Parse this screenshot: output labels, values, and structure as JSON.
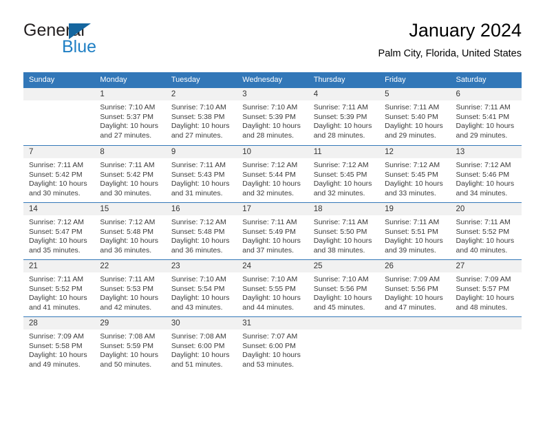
{
  "brand": {
    "name_part1": "General",
    "name_part2": "Blue",
    "triangle_color": "#15669f",
    "blue_color": "#1f7fc4"
  },
  "header": {
    "title": "January 2024",
    "subtitle": "Palm City, Florida, United States"
  },
  "theme": {
    "header_row_bg": "#3277b8",
    "daynum_band_bg": "#f1f1f1",
    "grid_line": "#3277b8",
    "text": "#3a3a3a"
  },
  "weekday_headers": [
    "Sunday",
    "Monday",
    "Tuesday",
    "Wednesday",
    "Thursday",
    "Friday",
    "Saturday"
  ],
  "labels": {
    "sunrise_prefix": "Sunrise:",
    "sunset_prefix": "Sunset:",
    "daylight_prefix": "Daylight:"
  },
  "weeks": [
    [
      {
        "day": "",
        "sunrise": "",
        "sunset": "",
        "daylight_line1": "",
        "daylight_line2": ""
      },
      {
        "day": "1",
        "sunrise": "Sunrise: 7:10 AM",
        "sunset": "Sunset: 5:37 PM",
        "daylight_line1": "Daylight: 10 hours",
        "daylight_line2": "and 27 minutes."
      },
      {
        "day": "2",
        "sunrise": "Sunrise: 7:10 AM",
        "sunset": "Sunset: 5:38 PM",
        "daylight_line1": "Daylight: 10 hours",
        "daylight_line2": "and 27 minutes."
      },
      {
        "day": "3",
        "sunrise": "Sunrise: 7:10 AM",
        "sunset": "Sunset: 5:39 PM",
        "daylight_line1": "Daylight: 10 hours",
        "daylight_line2": "and 28 minutes."
      },
      {
        "day": "4",
        "sunrise": "Sunrise: 7:11 AM",
        "sunset": "Sunset: 5:39 PM",
        "daylight_line1": "Daylight: 10 hours",
        "daylight_line2": "and 28 minutes."
      },
      {
        "day": "5",
        "sunrise": "Sunrise: 7:11 AM",
        "sunset": "Sunset: 5:40 PM",
        "daylight_line1": "Daylight: 10 hours",
        "daylight_line2": "and 29 minutes."
      },
      {
        "day": "6",
        "sunrise": "Sunrise: 7:11 AM",
        "sunset": "Sunset: 5:41 PM",
        "daylight_line1": "Daylight: 10 hours",
        "daylight_line2": "and 29 minutes."
      }
    ],
    [
      {
        "day": "7",
        "sunrise": "Sunrise: 7:11 AM",
        "sunset": "Sunset: 5:42 PM",
        "daylight_line1": "Daylight: 10 hours",
        "daylight_line2": "and 30 minutes."
      },
      {
        "day": "8",
        "sunrise": "Sunrise: 7:11 AM",
        "sunset": "Sunset: 5:42 PM",
        "daylight_line1": "Daylight: 10 hours",
        "daylight_line2": "and 30 minutes."
      },
      {
        "day": "9",
        "sunrise": "Sunrise: 7:11 AM",
        "sunset": "Sunset: 5:43 PM",
        "daylight_line1": "Daylight: 10 hours",
        "daylight_line2": "and 31 minutes."
      },
      {
        "day": "10",
        "sunrise": "Sunrise: 7:12 AM",
        "sunset": "Sunset: 5:44 PM",
        "daylight_line1": "Daylight: 10 hours",
        "daylight_line2": "and 32 minutes."
      },
      {
        "day": "11",
        "sunrise": "Sunrise: 7:12 AM",
        "sunset": "Sunset: 5:45 PM",
        "daylight_line1": "Daylight: 10 hours",
        "daylight_line2": "and 32 minutes."
      },
      {
        "day": "12",
        "sunrise": "Sunrise: 7:12 AM",
        "sunset": "Sunset: 5:45 PM",
        "daylight_line1": "Daylight: 10 hours",
        "daylight_line2": "and 33 minutes."
      },
      {
        "day": "13",
        "sunrise": "Sunrise: 7:12 AM",
        "sunset": "Sunset: 5:46 PM",
        "daylight_line1": "Daylight: 10 hours",
        "daylight_line2": "and 34 minutes."
      }
    ],
    [
      {
        "day": "14",
        "sunrise": "Sunrise: 7:12 AM",
        "sunset": "Sunset: 5:47 PM",
        "daylight_line1": "Daylight: 10 hours",
        "daylight_line2": "and 35 minutes."
      },
      {
        "day": "15",
        "sunrise": "Sunrise: 7:12 AM",
        "sunset": "Sunset: 5:48 PM",
        "daylight_line1": "Daylight: 10 hours",
        "daylight_line2": "and 36 minutes."
      },
      {
        "day": "16",
        "sunrise": "Sunrise: 7:12 AM",
        "sunset": "Sunset: 5:48 PM",
        "daylight_line1": "Daylight: 10 hours",
        "daylight_line2": "and 36 minutes."
      },
      {
        "day": "17",
        "sunrise": "Sunrise: 7:11 AM",
        "sunset": "Sunset: 5:49 PM",
        "daylight_line1": "Daylight: 10 hours",
        "daylight_line2": "and 37 minutes."
      },
      {
        "day": "18",
        "sunrise": "Sunrise: 7:11 AM",
        "sunset": "Sunset: 5:50 PM",
        "daylight_line1": "Daylight: 10 hours",
        "daylight_line2": "and 38 minutes."
      },
      {
        "day": "19",
        "sunrise": "Sunrise: 7:11 AM",
        "sunset": "Sunset: 5:51 PM",
        "daylight_line1": "Daylight: 10 hours",
        "daylight_line2": "and 39 minutes."
      },
      {
        "day": "20",
        "sunrise": "Sunrise: 7:11 AM",
        "sunset": "Sunset: 5:52 PM",
        "daylight_line1": "Daylight: 10 hours",
        "daylight_line2": "and 40 minutes."
      }
    ],
    [
      {
        "day": "21",
        "sunrise": "Sunrise: 7:11 AM",
        "sunset": "Sunset: 5:52 PM",
        "daylight_line1": "Daylight: 10 hours",
        "daylight_line2": "and 41 minutes."
      },
      {
        "day": "22",
        "sunrise": "Sunrise: 7:11 AM",
        "sunset": "Sunset: 5:53 PM",
        "daylight_line1": "Daylight: 10 hours",
        "daylight_line2": "and 42 minutes."
      },
      {
        "day": "23",
        "sunrise": "Sunrise: 7:10 AM",
        "sunset": "Sunset: 5:54 PM",
        "daylight_line1": "Daylight: 10 hours",
        "daylight_line2": "and 43 minutes."
      },
      {
        "day": "24",
        "sunrise": "Sunrise: 7:10 AM",
        "sunset": "Sunset: 5:55 PM",
        "daylight_line1": "Daylight: 10 hours",
        "daylight_line2": "and 44 minutes."
      },
      {
        "day": "25",
        "sunrise": "Sunrise: 7:10 AM",
        "sunset": "Sunset: 5:56 PM",
        "daylight_line1": "Daylight: 10 hours",
        "daylight_line2": "and 45 minutes."
      },
      {
        "day": "26",
        "sunrise": "Sunrise: 7:09 AM",
        "sunset": "Sunset: 5:56 PM",
        "daylight_line1": "Daylight: 10 hours",
        "daylight_line2": "and 47 minutes."
      },
      {
        "day": "27",
        "sunrise": "Sunrise: 7:09 AM",
        "sunset": "Sunset: 5:57 PM",
        "daylight_line1": "Daylight: 10 hours",
        "daylight_line2": "and 48 minutes."
      }
    ],
    [
      {
        "day": "28",
        "sunrise": "Sunrise: 7:09 AM",
        "sunset": "Sunset: 5:58 PM",
        "daylight_line1": "Daylight: 10 hours",
        "daylight_line2": "and 49 minutes."
      },
      {
        "day": "29",
        "sunrise": "Sunrise: 7:08 AM",
        "sunset": "Sunset: 5:59 PM",
        "daylight_line1": "Daylight: 10 hours",
        "daylight_line2": "and 50 minutes."
      },
      {
        "day": "30",
        "sunrise": "Sunrise: 7:08 AM",
        "sunset": "Sunset: 6:00 PM",
        "daylight_line1": "Daylight: 10 hours",
        "daylight_line2": "and 51 minutes."
      },
      {
        "day": "31",
        "sunrise": "Sunrise: 7:07 AM",
        "sunset": "Sunset: 6:00 PM",
        "daylight_line1": "Daylight: 10 hours",
        "daylight_line2": "and 53 minutes."
      },
      {
        "day": "",
        "sunrise": "",
        "sunset": "",
        "daylight_line1": "",
        "daylight_line2": ""
      },
      {
        "day": "",
        "sunrise": "",
        "sunset": "",
        "daylight_line1": "",
        "daylight_line2": ""
      },
      {
        "day": "",
        "sunrise": "",
        "sunset": "",
        "daylight_line1": "",
        "daylight_line2": ""
      }
    ]
  ]
}
